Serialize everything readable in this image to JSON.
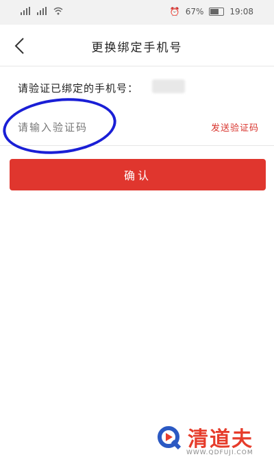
{
  "status_bar": {
    "left_icons": [
      "sim-signal-icon",
      "sim-signal-icon",
      "wifi-icon"
    ],
    "battery_text": "67%",
    "time": "19:08"
  },
  "nav": {
    "title": "更换绑定手机号",
    "back_icon": "chevron-left-icon"
  },
  "verify": {
    "label": "请验证已绑定的手机号：",
    "code_placeholder": "请输入验证码",
    "send_code_label": "发送验证码"
  },
  "confirm": {
    "label": "确认"
  },
  "watermark": {
    "brand": "清道夫",
    "url": "WWW.QDFUJI.COM"
  },
  "colors": {
    "accent_red": "#e0362e",
    "annotation_blue": "#1a1fd6"
  }
}
